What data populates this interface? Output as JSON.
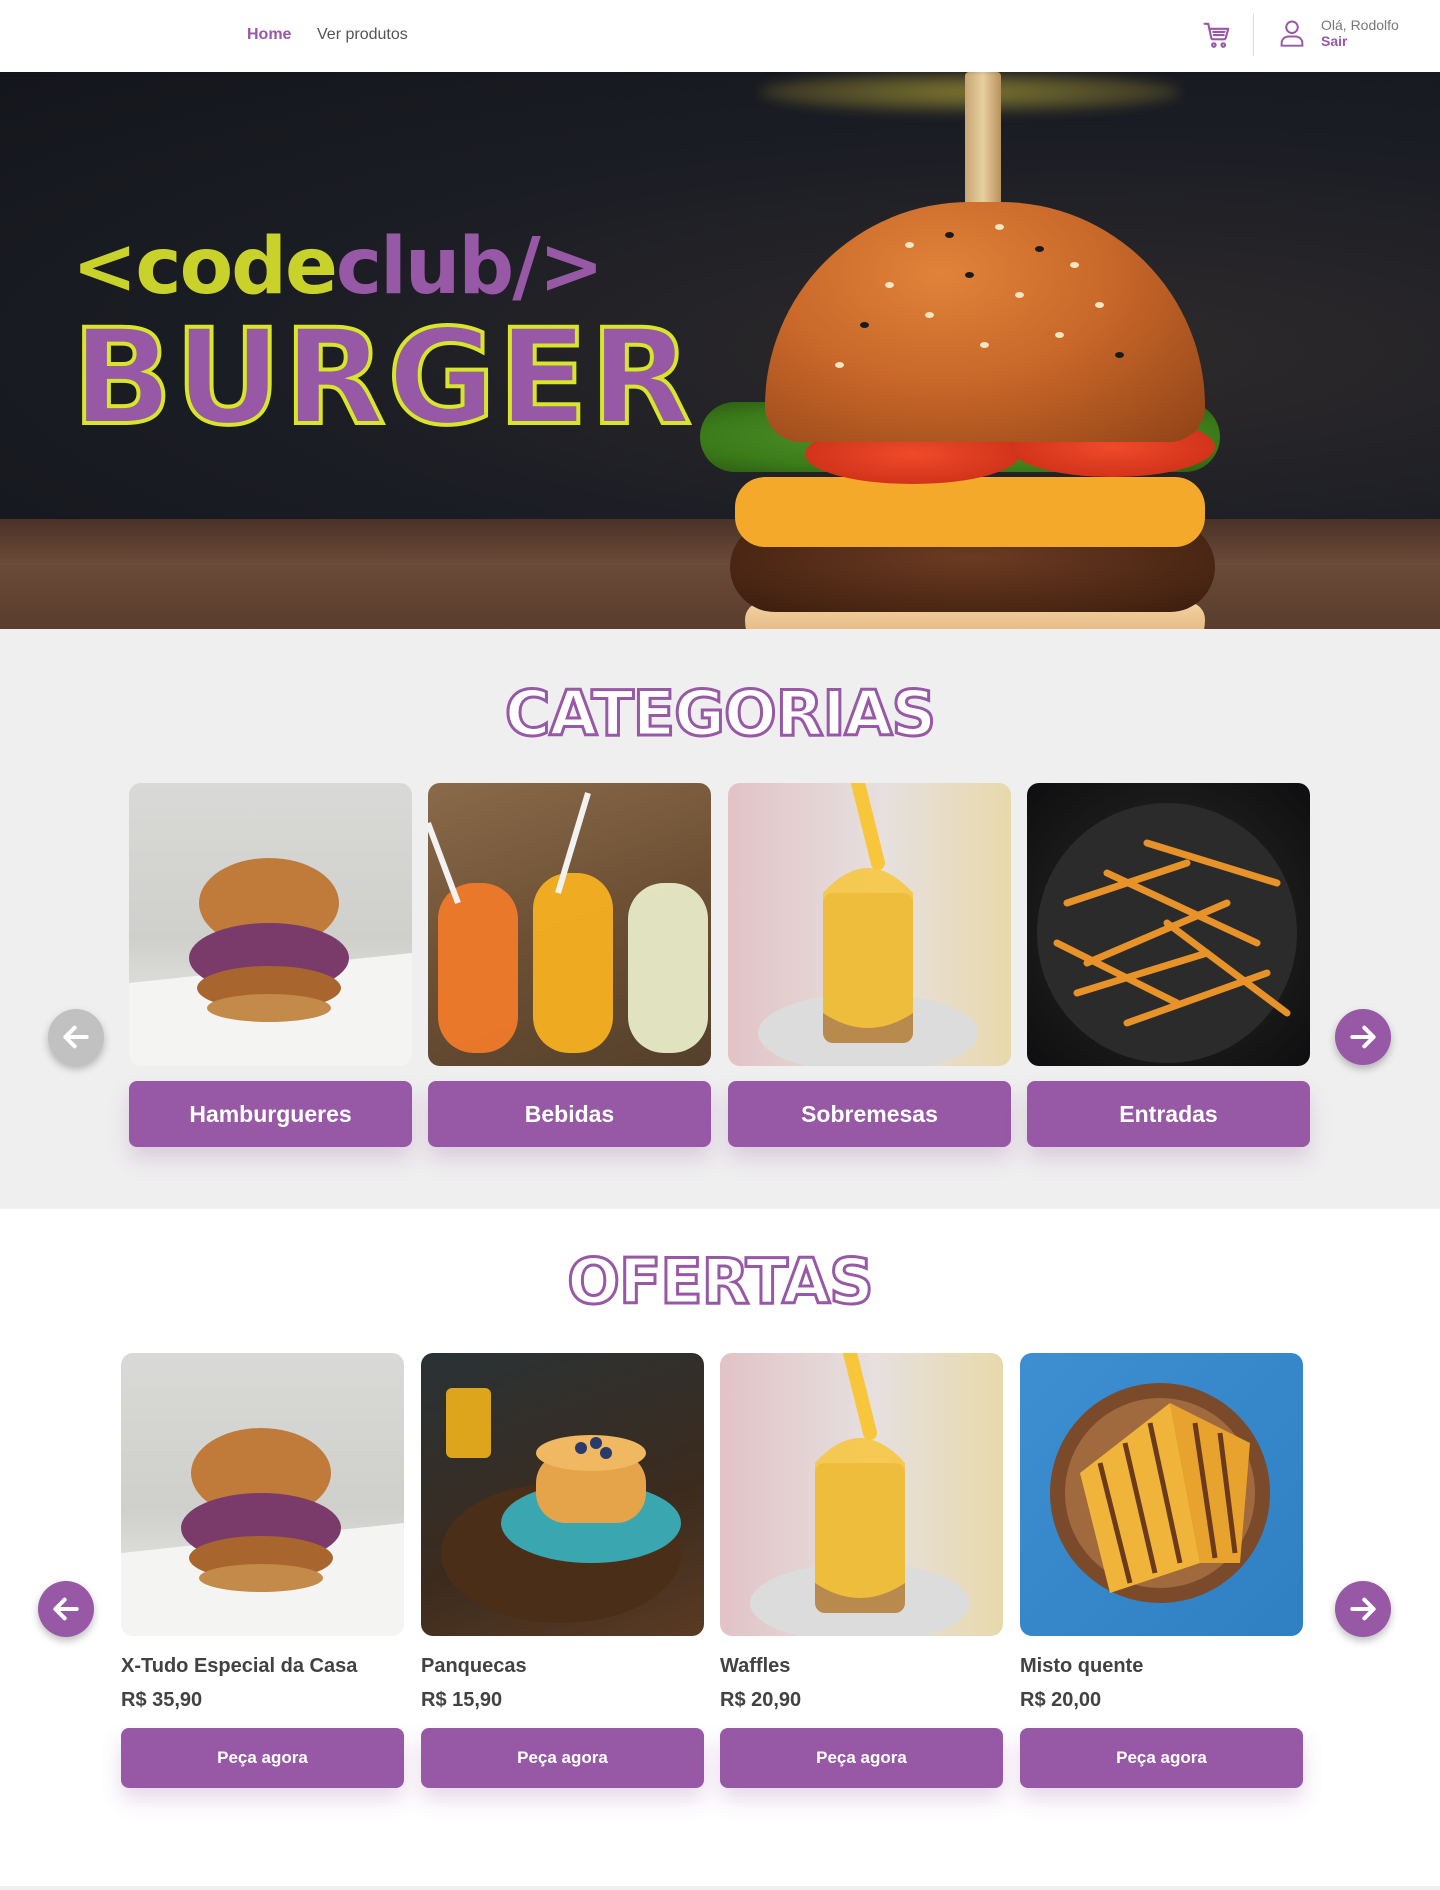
{
  "header": {
    "nav": [
      {
        "label": "Home",
        "active": true
      },
      {
        "label": "Ver produtos",
        "active": false
      }
    ],
    "greeting": "Olá, Rodolfo",
    "logout": "Sair",
    "cart_icon": "cart-icon",
    "user_icon": "user-icon"
  },
  "hero": {
    "logo_part1": "<code",
    "logo_part2": "club/>",
    "logo_word": "BURGER"
  },
  "categories": {
    "title": "CATEGORIAS",
    "items": [
      {
        "label": "Hamburgueres",
        "image": "burger"
      },
      {
        "label": "Bebidas",
        "image": "drinks"
      },
      {
        "label": "Sobremesas",
        "image": "waffles"
      },
      {
        "label": "Entradas",
        "image": "fries"
      }
    ]
  },
  "offers": {
    "title": "OFERTAS",
    "items": [
      {
        "name": "X-Tudo Especial da Casa",
        "price": "R$ 35,90",
        "button": "Peça agora",
        "image": "burger"
      },
      {
        "name": "Panquecas",
        "price": "R$ 15,90",
        "button": "Peça agora",
        "image": "pancakes"
      },
      {
        "name": "Waffles",
        "price": "R$ 20,90",
        "button": "Peça agora",
        "image": "waffles"
      },
      {
        "name": "Misto quente",
        "price": "R$ 20,00",
        "button": "Peça agora",
        "image": "sandwich"
      }
    ]
  },
  "colors": {
    "accent": "#9758A6",
    "logo_yellow": "#C9D22A",
    "section_bg": "#EFEFEF",
    "arrow_disabled": "#C1C1C1"
  }
}
